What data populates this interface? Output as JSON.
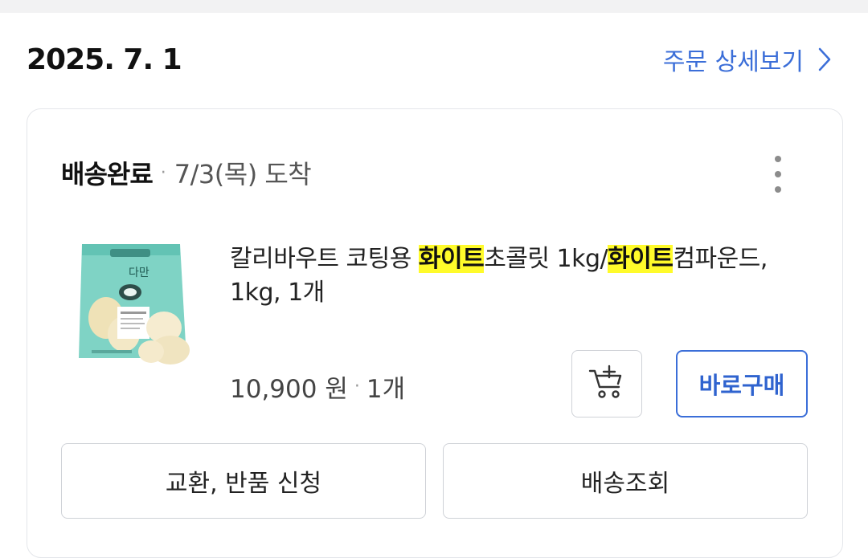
{
  "order": {
    "date": "2025. 7. 1",
    "detail_link": "주문 상세보기"
  },
  "shipment": {
    "status": "배송완료",
    "separator": "·",
    "arrival": "7/3(목) 도착"
  },
  "product": {
    "title_parts": [
      {
        "text": "칼리바우트 코팅용 ",
        "highlight": false
      },
      {
        "text": "화이트",
        "highlight": true
      },
      {
        "text": "초콜릿 1kg/",
        "highlight": false
      },
      {
        "text": "화이트",
        "highlight": true
      },
      {
        "text": "컴파운드, 1kg, 1개",
        "highlight": false
      }
    ],
    "price": "10,900 원",
    "quantity": "1개",
    "image_icon": "white-chocolate-package-image"
  },
  "actions": {
    "cart_icon": "add-to-cart-icon",
    "buy_now": "바로구매",
    "exchange_return": "교환, 반품 신청",
    "track_delivery": "배송조회"
  },
  "colors": {
    "accent": "#3b6ed8",
    "highlight": "#fffb2a",
    "package": "#7fd3c5"
  }
}
